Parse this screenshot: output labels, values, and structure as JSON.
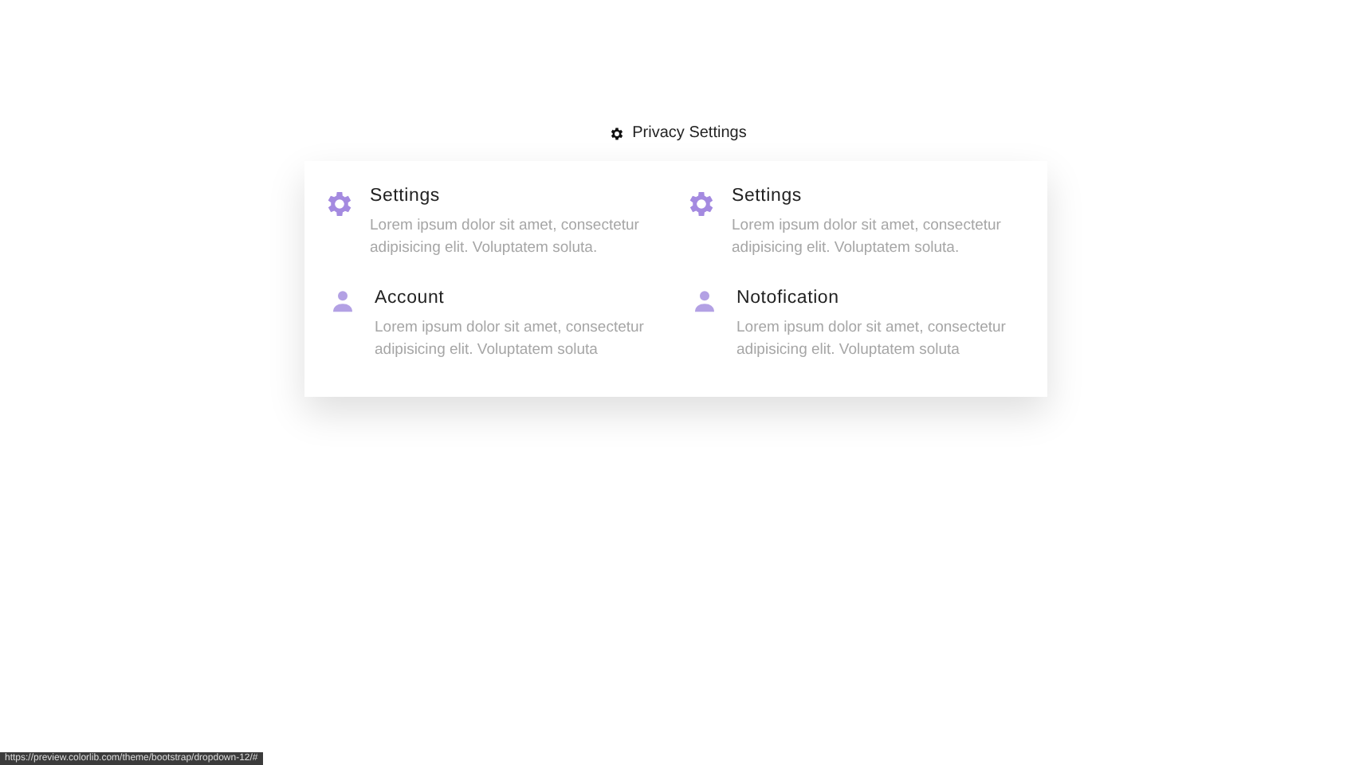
{
  "trigger": {
    "label": "Privacy Settings"
  },
  "menu": {
    "items": [
      {
        "kind": "gear",
        "title": "Settings",
        "text": "Lorem ipsum dolor sit amet, consectetur adipisicing elit. Voluptatem soluta."
      },
      {
        "kind": "gear",
        "title": "Settings",
        "text": "Lorem ipsum dolor sit amet, consectetur adipisicing elit. Voluptatem soluta."
      },
      {
        "kind": "person",
        "title": "Account",
        "text": "Lorem ipsum dolor sit amet, consectetur adipisicing elit. Voluptatem soluta"
      },
      {
        "kind": "person",
        "title": "Notofication",
        "text": "Lorem ipsum dolor sit amet, consectetur adipisicing elit. Voluptatem soluta"
      }
    ]
  },
  "status_bar": {
    "url": "https://preview.colorlib.com/theme/bootstrap/dropdown-12/#"
  }
}
